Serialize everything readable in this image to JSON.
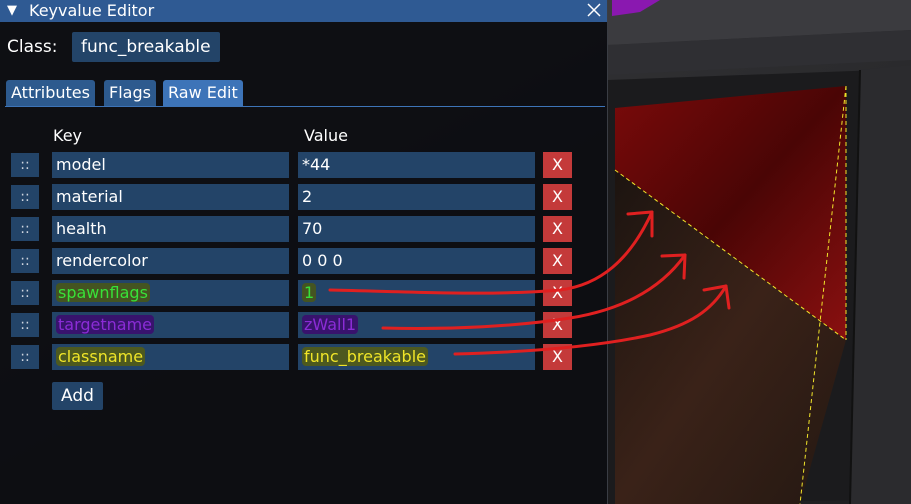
{
  "window": {
    "title": "Keyvalue Editor"
  },
  "class_row": {
    "label": "Class:",
    "value": "func_breakable"
  },
  "tabs": [
    {
      "label": "Attributes",
      "active": false
    },
    {
      "label": "Flags",
      "active": false
    },
    {
      "label": "Raw Edit",
      "active": true
    }
  ],
  "columns": {
    "key": "Key",
    "value": "Value"
  },
  "rows": [
    {
      "handle": "::",
      "key": "model",
      "value": "*44",
      "delete": "X"
    },
    {
      "handle": "::",
      "key": "material",
      "value": "2",
      "delete": "X"
    },
    {
      "handle": "::",
      "key": "health",
      "value": "70",
      "delete": "X"
    },
    {
      "handle": "::",
      "key": "rendercolor",
      "value": "0 0 0",
      "delete": "X"
    },
    {
      "handle": "::",
      "key": "spawnflags",
      "value": "1",
      "delete": "X"
    },
    {
      "handle": "::",
      "key": "targetname",
      "value": "zWall1",
      "delete": "X"
    },
    {
      "handle": "::",
      "key": "classname",
      "value": "func_breakable",
      "delete": "X"
    }
  ],
  "add_button": "Add",
  "colors": {
    "titlebar": "#2f5a93",
    "field": "#234468",
    "delete": "#c43a3a",
    "highlight_green": "#38e238",
    "highlight_purple": "#8b2cd6",
    "highlight_yellow": "#f0e528",
    "annotation_arrow": "#e02020"
  },
  "icons": {
    "collapse": "triangle-down-icon",
    "close": "close-icon"
  }
}
